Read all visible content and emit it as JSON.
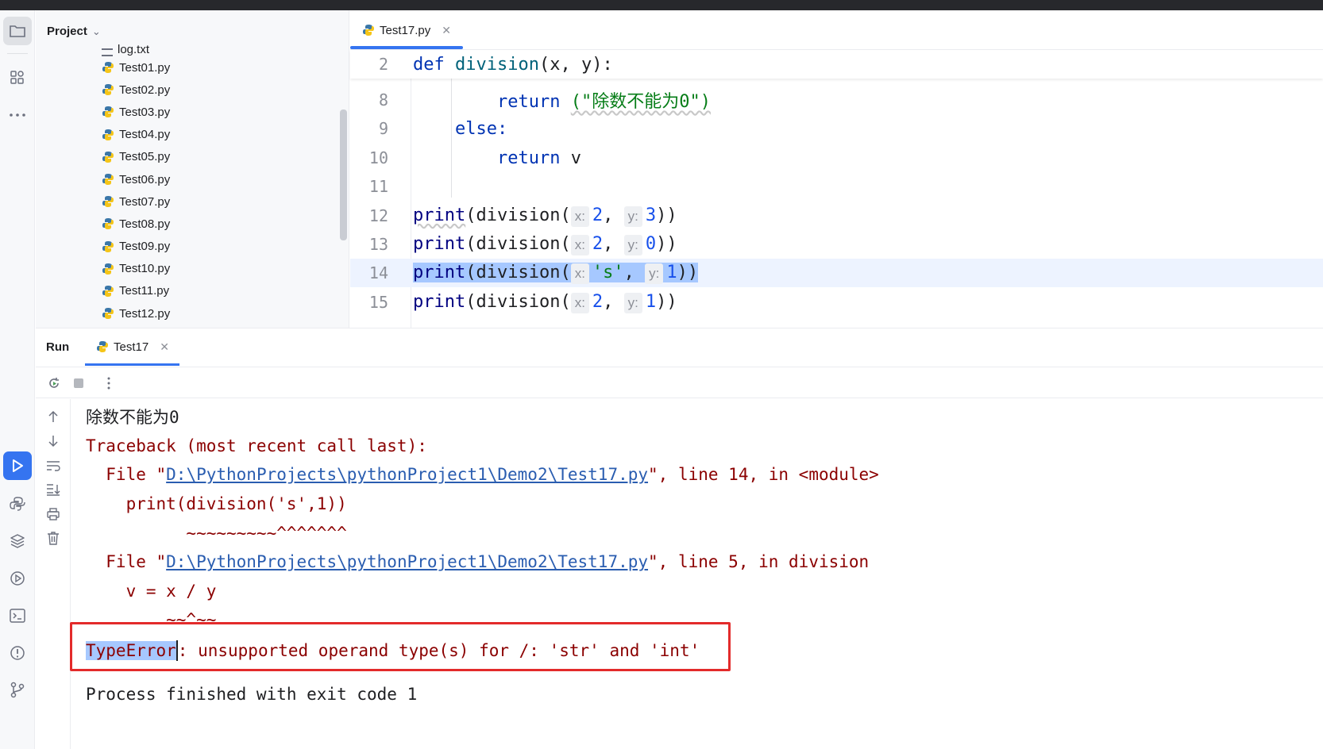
{
  "sidebar": {
    "project_label": "Project",
    "files": [
      "log.txt",
      "Test01.py",
      "Test02.py",
      "Test03.py",
      "Test04.py",
      "Test05.py",
      "Test06.py",
      "Test07.py",
      "Test08.py",
      "Test09.py",
      "Test10.py",
      "Test11.py",
      "Test12.py"
    ]
  },
  "editor": {
    "tab_label": "Test17.py",
    "lines": {
      "l2": {
        "num": "2"
      },
      "l8": {
        "num": "8"
      },
      "l9": {
        "num": "9"
      },
      "l10": {
        "num": "10"
      },
      "l11": {
        "num": "11"
      },
      "l12": {
        "num": "12"
      },
      "l13": {
        "num": "13"
      },
      "l14": {
        "num": "14"
      },
      "l15": {
        "num": "15"
      }
    },
    "tokens": {
      "def": "def",
      "division": "division",
      "params": "(x, y):",
      "return": "return",
      "zero_msg": "(\"除数不能为0\")",
      "else": "else:",
      "return_v": " v",
      "print": "print",
      "call": "(division(",
      "hint_x": "x:",
      "hint_y": "y:",
      "two": "2",
      "three": "3",
      "zero": "0",
      "one": "1",
      "s_str": "'s'",
      "comma": ", ",
      "comma2": ",",
      "close": "))"
    }
  },
  "run": {
    "title": "Run",
    "tab_label": "Test17",
    "console": {
      "line1": "除数不能为0",
      "line2": "Traceback (most recent call last):",
      "line3_pre": "  File \"",
      "path": "D:\\PythonProjects\\pythonProject1\\Demo2\\Test17.py",
      "line3_post": "\", line 14, in <module>",
      "line4": "    print(division('s',1))",
      "line5": "          ~~~~~~~~~^^^^^^^",
      "line6_post": "\", line 5, in division",
      "line7": "    v = x / y",
      "line8": "        ~~^~~",
      "error_type": "TypeError",
      "error_msg": ": unsupported operand type(s) for /: 'str' and 'int'",
      "line10": "Process finished with exit code 1"
    }
  },
  "colors": {
    "accent": "#3574f0",
    "error": "#8b0000",
    "highlight_box": "#e32b2b"
  }
}
